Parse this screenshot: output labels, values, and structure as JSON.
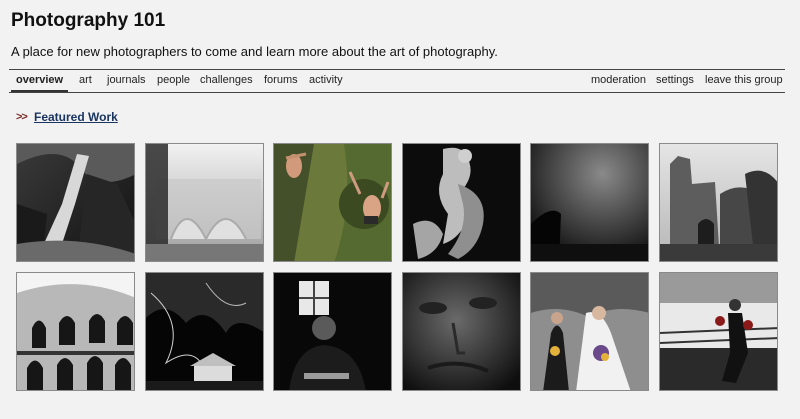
{
  "header": {
    "title": "Photography 101",
    "description": "A place for new photographers to come and learn more about the art of photography."
  },
  "nav": {
    "left": [
      {
        "label": "overview",
        "active": true
      },
      {
        "label": "art"
      },
      {
        "label": "journals"
      },
      {
        "label": "people"
      },
      {
        "label": "challenges"
      },
      {
        "label": "forums"
      },
      {
        "label": "activity"
      }
    ],
    "right": [
      {
        "label": "moderation"
      },
      {
        "label": "settings"
      },
      {
        "label": "leave this group"
      }
    ]
  },
  "featured": {
    "arrows": ">>",
    "label": "Featured Work"
  },
  "thumbnails": [
    {
      "name": "waterfall"
    },
    {
      "name": "misty-bridge"
    },
    {
      "name": "cliff-divers"
    },
    {
      "name": "sculpture"
    },
    {
      "name": "dark-silhouette"
    },
    {
      "name": "castle-ruin"
    },
    {
      "name": "colosseum"
    },
    {
      "name": "house-trees"
    },
    {
      "name": "person-window"
    },
    {
      "name": "face-closeup"
    },
    {
      "name": "wedding"
    },
    {
      "name": "boxing-gym"
    }
  ]
}
